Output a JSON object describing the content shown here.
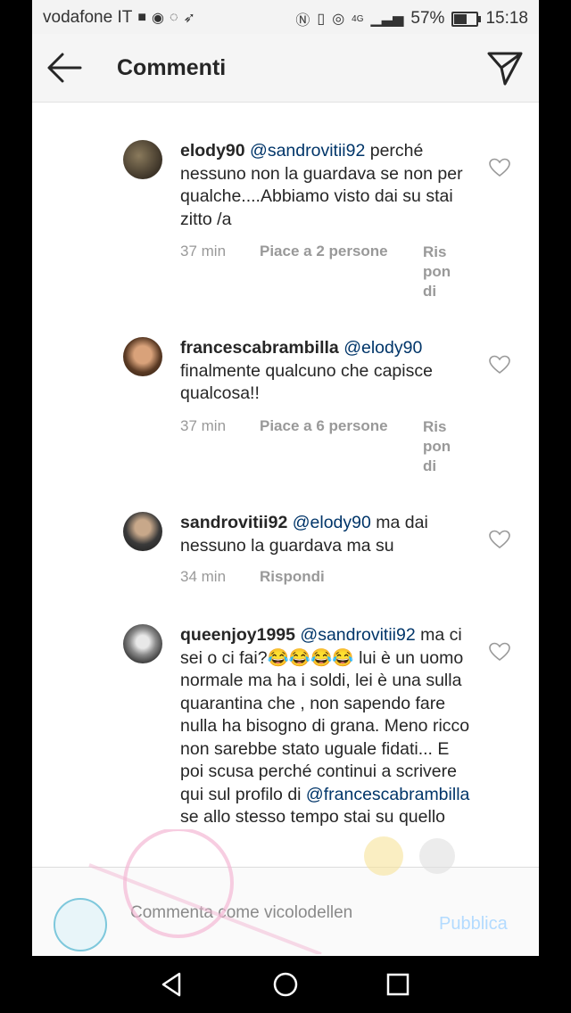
{
  "status_bar": {
    "carrier": "vodafone IT",
    "network": "4G",
    "battery": "57%",
    "time": "15:18"
  },
  "header": {
    "title": "Commenti",
    "back_icon": "arrow-left-icon",
    "send_icon": "direct-send-icon"
  },
  "comments": [
    {
      "username": "elody90",
      "mention": "@sandrovitii92",
      "text": " perché nessuno  non la guardava se non per qualche....Abbiamo visto dai su stai zitto /a",
      "time": "37 min",
      "likes": "Piace a 2 persone",
      "reply": "Rispondi"
    },
    {
      "username": "francescabrambilla",
      "mention": "@elody90",
      "text": " finalmente qualcuno che capisce qualcosa!!",
      "time": "37 min",
      "likes": "Piace a 6 persone",
      "reply": "Rispondi"
    },
    {
      "username": "sandrovitii92",
      "mention": "@elody90",
      "text": " ma dai nessuno la guardava ma su",
      "time": "34 min",
      "likes": "",
      "reply": "Rispondi"
    },
    {
      "username": "queenjoy1995",
      "mention": "@sandrovitii92",
      "text": " ma ci sei o ci fai?😂😂😂😂 lui è un uomo normale ma ha i soldi, lei è una sulla quarantina che , non sapendo fare nulla ha bisogno di grana. Meno ricco non sarebbe stato uguale fidati... E poi scusa perché continui a scrivere qui sul profilo di ",
      "mention2": "@francescabrambilla",
      "text2": " se allo stesso tempo stai su quello",
      "time": "",
      "likes": "",
      "reply": ""
    }
  ],
  "composer": {
    "placeholder": "Commenta come vicolodellenewsofficial...",
    "publish_label": "Pubblica"
  },
  "colors": {
    "mention": "#003569",
    "publish_disabled": "#b3dbff",
    "meta_text": "#999999"
  }
}
